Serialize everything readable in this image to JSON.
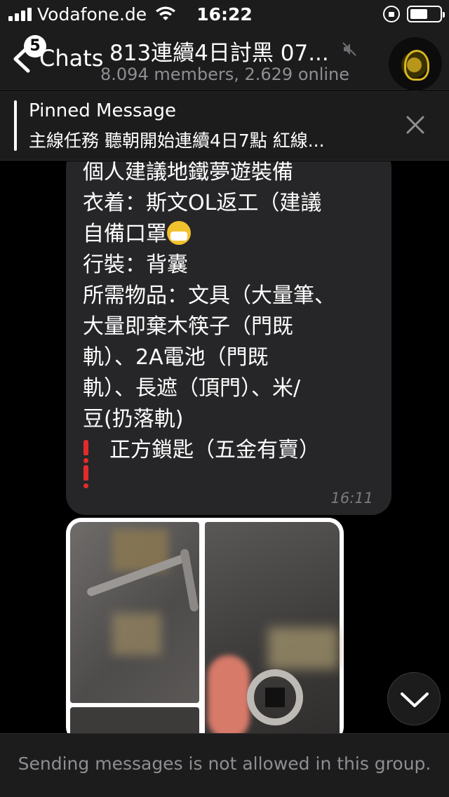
{
  "status_bar": {
    "carrier": "Vodafone.de",
    "time": "16:22",
    "battery_level": 0.6
  },
  "nav": {
    "back_badge": "5",
    "back_label": "Chats",
    "title": "813連續4日討黑 07...",
    "subtitle": "8.094 members, 2.629 online"
  },
  "pinned": {
    "title": "Pinned Message",
    "text": "主線任務 聽朝開始連續4日7點 紅線..."
  },
  "message": {
    "lines": [
      "個人建議地鐵夢遊裝備",
      "衣着：斯文OL返工（建議",
      "自備口罩",
      "行裝：背囊",
      "所需物品：文具（大量筆、",
      "大量即棄木筷子（門既",
      "軌）、2A電池（門既",
      "軌）、長遮（頂門）、米/",
      "豆(扔落軌)",
      "正方鎖匙（五金有賣）"
    ],
    "time": "16:11"
  },
  "composer": {
    "disabled_text": "Sending messages is not allowed in this group."
  },
  "icons": [
    "signal-icon",
    "wifi-icon",
    "rotation-lock-icon",
    "battery-icon",
    "back-chevron-icon",
    "mute-icon",
    "close-icon",
    "chevron-down-icon",
    "exclamation-icon",
    "mask-emoji-icon"
  ],
  "colors": {
    "background": "#000000",
    "bar": "#1c1c1d",
    "bubble": "#262628",
    "secondary_text": "#8e8e93",
    "exclamation": "#e32b2b"
  }
}
